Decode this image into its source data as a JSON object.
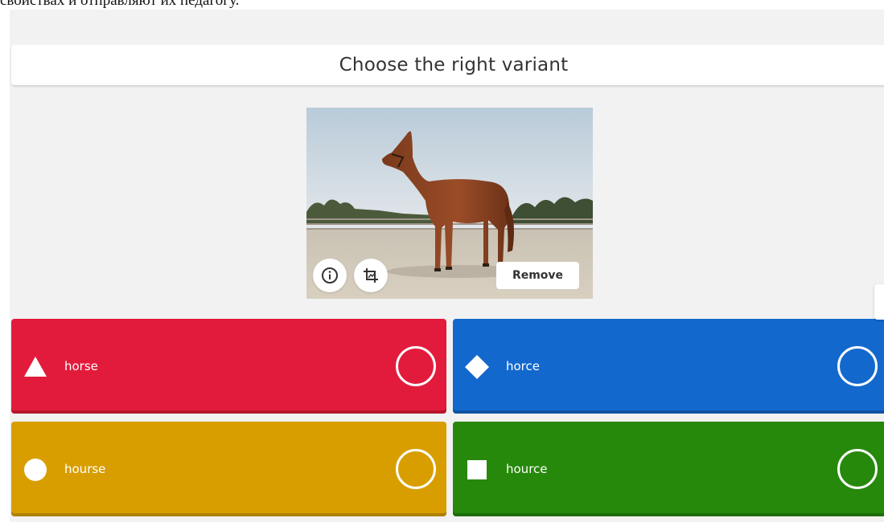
{
  "page": {
    "top_caption": "свойствах и отправляют их педагогу."
  },
  "question": {
    "title": "Choose the right variant"
  },
  "media": {
    "remove_label": "Remove",
    "info_icon": "info-icon",
    "crop_icon": "crop-icon"
  },
  "answers": [
    {
      "label": "horse",
      "shape": "triangle-icon",
      "color": "#e21b3c"
    },
    {
      "label": "horce",
      "shape": "diamond-icon",
      "color": "#1368ce"
    },
    {
      "label": "hourse",
      "shape": "circle-icon",
      "color": "#d89e00"
    },
    {
      "label": "hource",
      "shape": "square-icon",
      "color": "#26890c"
    }
  ]
}
